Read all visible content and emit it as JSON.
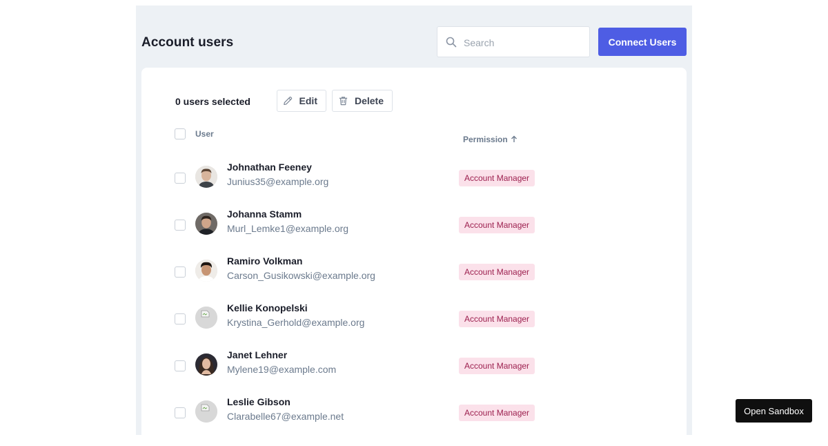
{
  "header": {
    "title": "Account users",
    "search_placeholder": "Search",
    "search_value": "",
    "connect_label": "Connect Users"
  },
  "toolbar": {
    "selected_count": "0 users selected",
    "edit_label": "Edit",
    "delete_label": "Delete"
  },
  "table": {
    "col_user": "User",
    "col_permission": "Permission",
    "rows": [
      {
        "name": "Johnathan Feeney",
        "email": "Junius35@example.org",
        "permission": "Account Manager",
        "avatar": "photo"
      },
      {
        "name": "Johanna Stamm",
        "email": "Murl_Lemke1@example.org",
        "permission": "Account Manager",
        "avatar": "photo"
      },
      {
        "name": "Ramiro Volkman",
        "email": "Carson_Gusikowski@example.org",
        "permission": "Account Manager",
        "avatar": "photo"
      },
      {
        "name": "Kellie Konopelski",
        "email": "Krystina_Gerhold@example.org",
        "permission": "Account Manager",
        "avatar": "broken-image"
      },
      {
        "name": "Janet Lehner",
        "email": "Mylene19@example.com",
        "permission": "Account Manager",
        "avatar": "photo"
      },
      {
        "name": "Leslie Gibson",
        "email": "Clarabelle67@example.net",
        "permission": "Account Manager",
        "avatar": "broken-image"
      }
    ]
  },
  "sandbox_label": "Open Sandbox",
  "colors": {
    "primary": "#4e5de4",
    "panel_bg": "#edf1f5",
    "badge_bg": "#fbe1ea",
    "badge_text": "#9c1f4e",
    "muted_text": "#6b7a8d"
  }
}
